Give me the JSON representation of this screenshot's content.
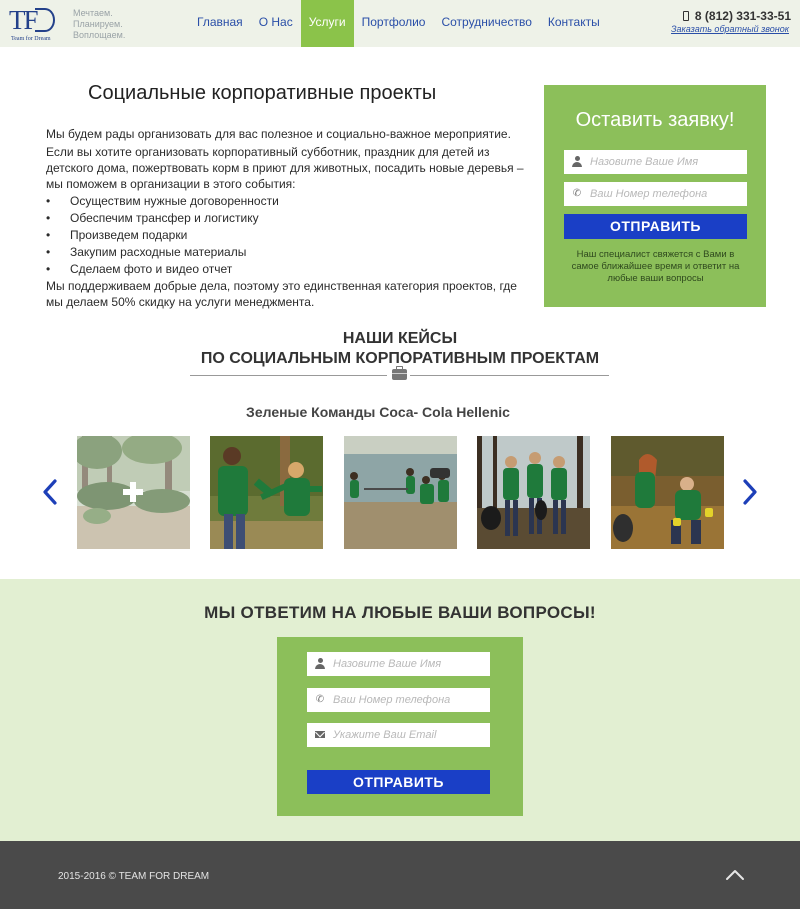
{
  "header": {
    "logo_text": "TFD",
    "logo_sub": "Team for Dream",
    "slogan": [
      "Мечтаем.",
      "Планируем.",
      "Воплощаем."
    ],
    "nav": [
      "Главная",
      "О Нас",
      "Услуги",
      "Портфолио",
      "Сотрудничество",
      "Контакты"
    ],
    "active_nav": "Услуги",
    "phone": "8 (812) 331-33-51",
    "callback_link": "Заказать обратный звонок"
  },
  "intro": {
    "title": "Социальные корпоративные проекты",
    "para1": "Мы будем рады организовать для вас полезное и социально-важное мероприятие.",
    "para2": "Если вы хотите организовать корпоративный субботник, праздник для детей из детского дома, пожертвовать корм в приют для животных,  посадить новые деревья – мы поможем в организации в этого события:",
    "bullets": [
      "Осуществим нужные договоренности",
      "Обеспечим трансфер и логистику",
      "Произведем подарки",
      "Закупим расходные материалы",
      "Сделаем фото и видео отчет"
    ],
    "para3": "Мы поддерживаем добрые дела, поэтому это единственная  категория проектов, где мы делаем 50% скидку на услуги менеджмента."
  },
  "side_form": {
    "title": "Оставить заявку!",
    "name_placeholder": "Назовите Ваше Имя",
    "phone_placeholder": "Ваш Номер телефона",
    "submit": "ОТПРАВИТЬ",
    "note": "Наш специалист свяжется с Вами в самое ближайшее время и ответит на любые ваши вопросы"
  },
  "cases": {
    "title_line1": "НАШИ КЕЙСЫ",
    "title_line2": "ПО СОЦИАЛЬНЫМ КОРПОРАТИВНЫМ ПРОЕКТАМ",
    "subtitle": "Зеленые Команды Coca- Cola Hellenic"
  },
  "contact": {
    "title": "МЫ ОТВЕТИМ НА ЛЮБЫЕ ВАШИ ВОПРОСЫ!",
    "name_placeholder": "Назовите Ваше Имя",
    "phone_placeholder": "Ваш Номер телефона",
    "email_placeholder": "Укажите Ваш Email",
    "submit": "ОТПРАВИТЬ"
  },
  "footer": {
    "copyright": "2015-2016 © TEAM FOR DREAM"
  },
  "colors": {
    "accent_green": "#8cbf5a",
    "nav_active": "#8bc34a",
    "button_blue": "#1a3fc6",
    "link_blue": "#2a4fa8",
    "footer_bg": "#4a4a4a",
    "section_bg": "#e2efd2"
  },
  "icons": [
    "phone-icon",
    "user-icon",
    "handset-icon",
    "briefcase-icon",
    "chevron-left-icon",
    "chevron-right-icon",
    "plus-icon",
    "envelope-icon",
    "chevron-up-icon"
  ]
}
